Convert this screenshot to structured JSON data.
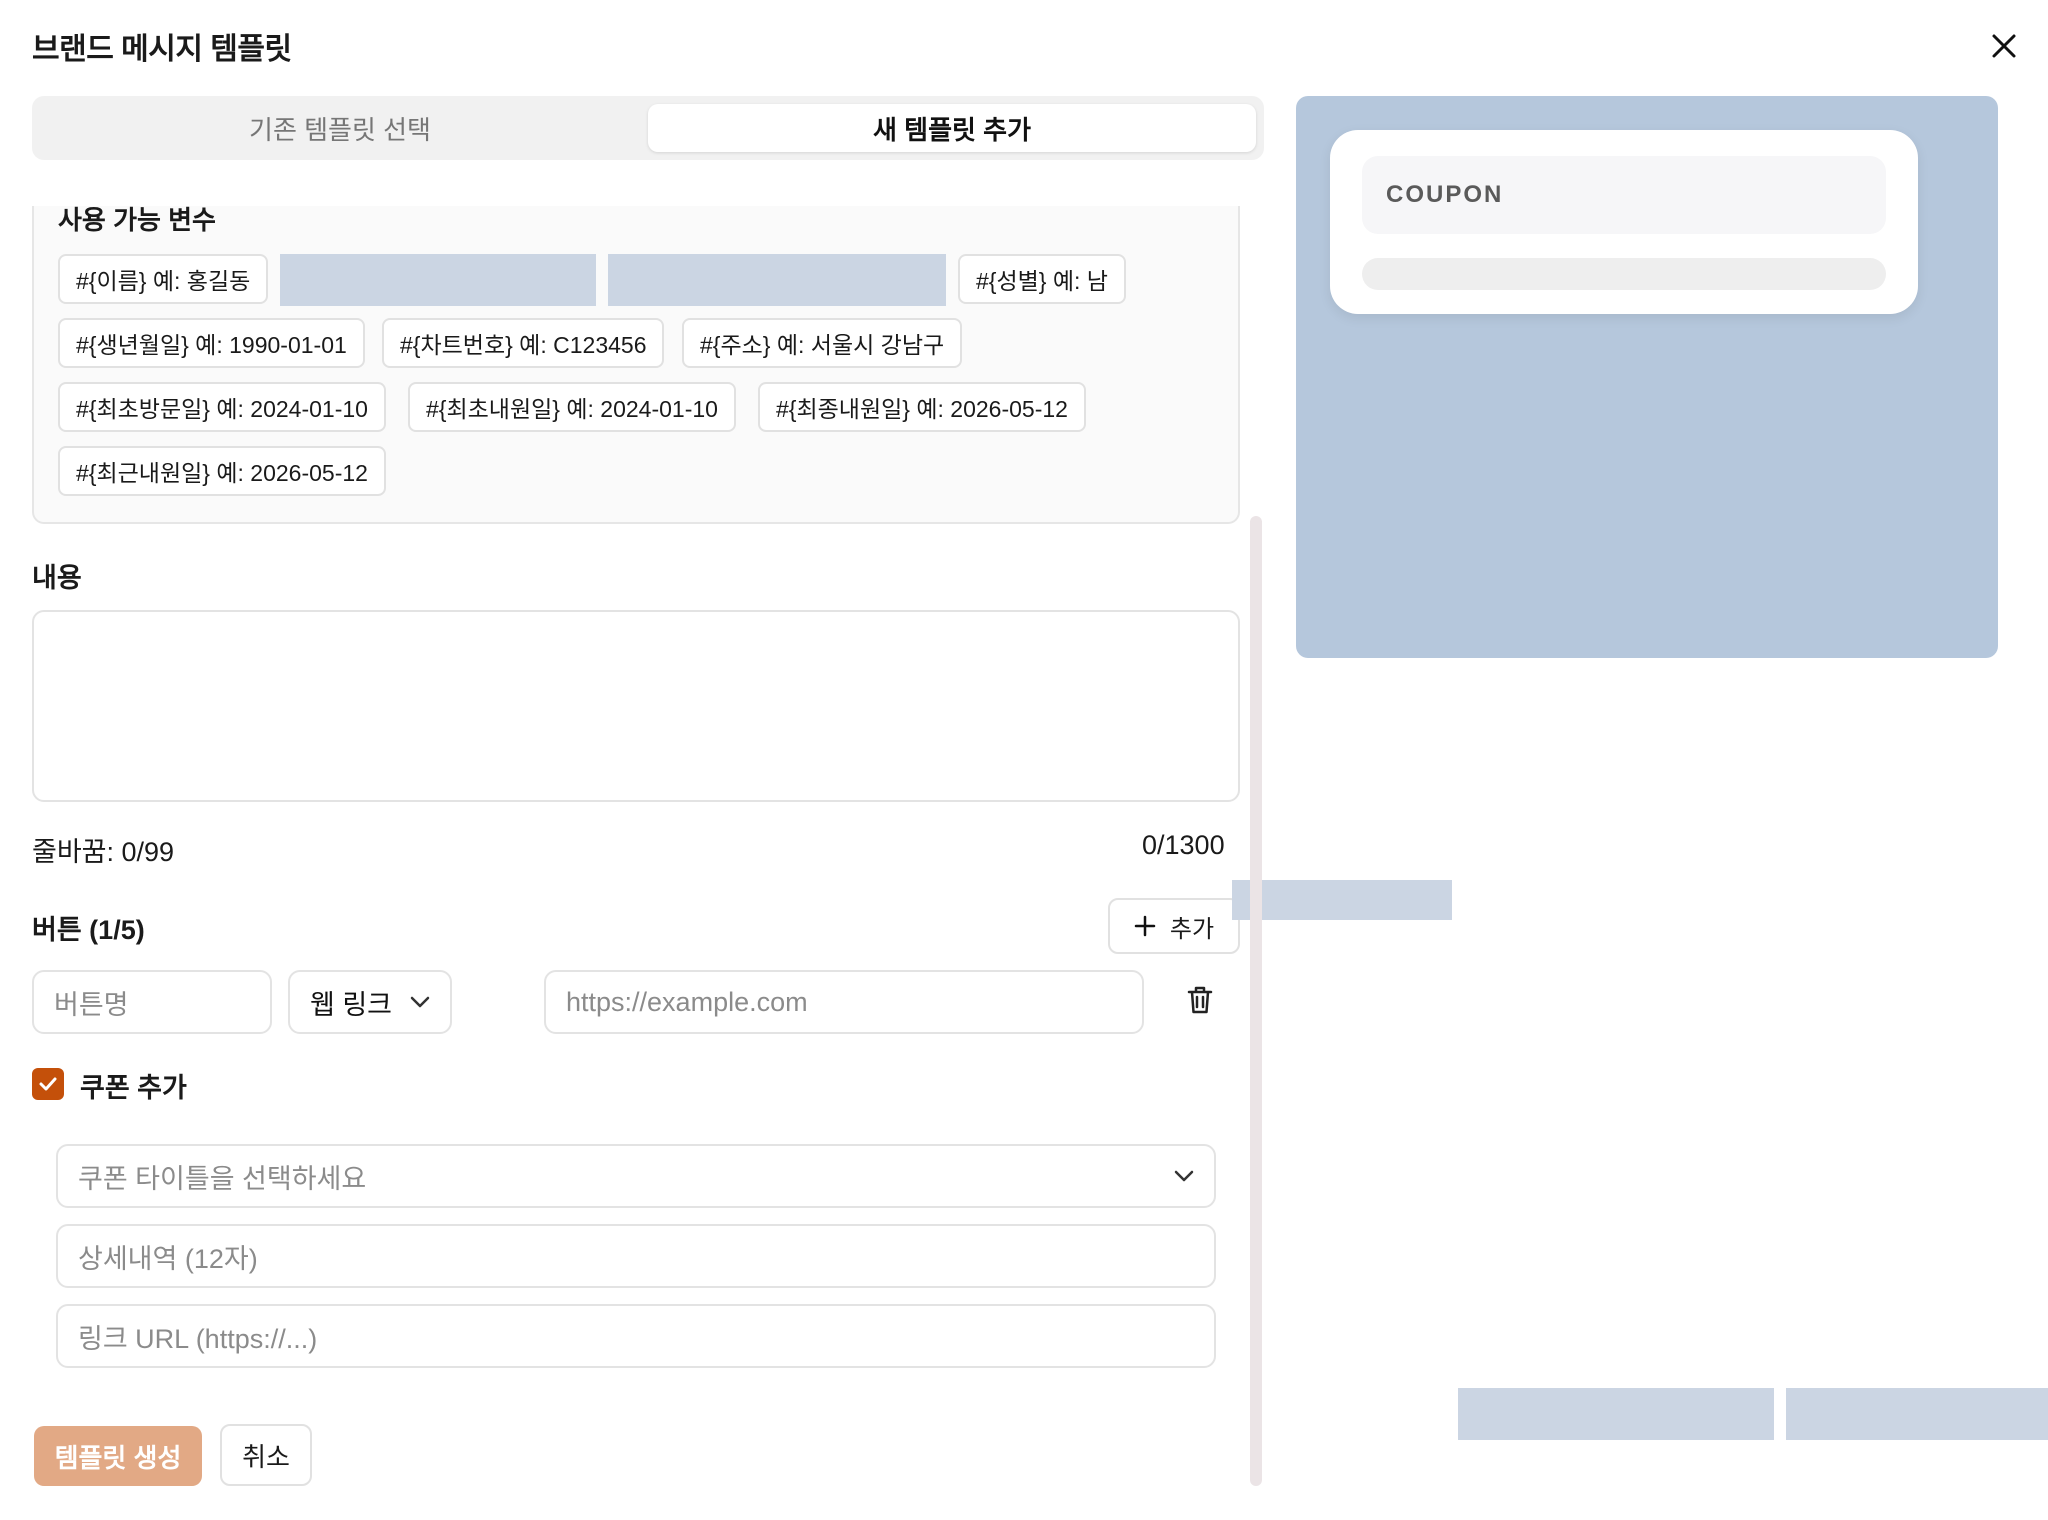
{
  "modal": {
    "title": "브랜드 메시지 템플릿"
  },
  "tabs": [
    {
      "label": "기존 템플릿 선택",
      "active": false
    },
    {
      "label": "새 템플릿 추가",
      "active": true
    }
  ],
  "variables": {
    "title": "사용 가능 변수",
    "chips": [
      "#{이름} 예: 홍길동",
      "#{성별} 예: 남",
      "#{생년월일} 예: 1990-01-01",
      "#{차트번호} 예: C123456",
      "#{주소} 예: 서울시 강남구",
      "#{최초방문일} 예: 2024-01-10",
      "#{최초내원일} 예: 2024-01-10",
      "#{최종내원일} 예: 2026-05-12",
      "#{최근내원일} 예: 2026-05-12"
    ]
  },
  "content": {
    "label": "내용",
    "line_breaks": "줄바꿈: 0/99",
    "char_count": "0/1300"
  },
  "buttons_section": {
    "label": "버튼 (1/5)",
    "add_label": "추가",
    "button_name_placeholder": "버튼명",
    "type_value": "웹 링크",
    "url_placeholder": "https://example.com"
  },
  "coupon": {
    "checkbox_label": "쿠폰 추가",
    "checked": true,
    "title_select_placeholder": "쿠폰 타이틀을 선택하세요",
    "detail_placeholder": "상세내역 (12자)",
    "link_placeholder": "링크 URL (https://...)"
  },
  "actions": {
    "create_label": "템플릿 생성",
    "cancel_label": "취소"
  },
  "preview": {
    "coupon_text": "COUPON"
  },
  "colors": {
    "accent": "#c4500a",
    "primary_button": "#e2a985",
    "preview_bg": "#b5c7dc",
    "placeholder_block": "#cbd5e3"
  }
}
